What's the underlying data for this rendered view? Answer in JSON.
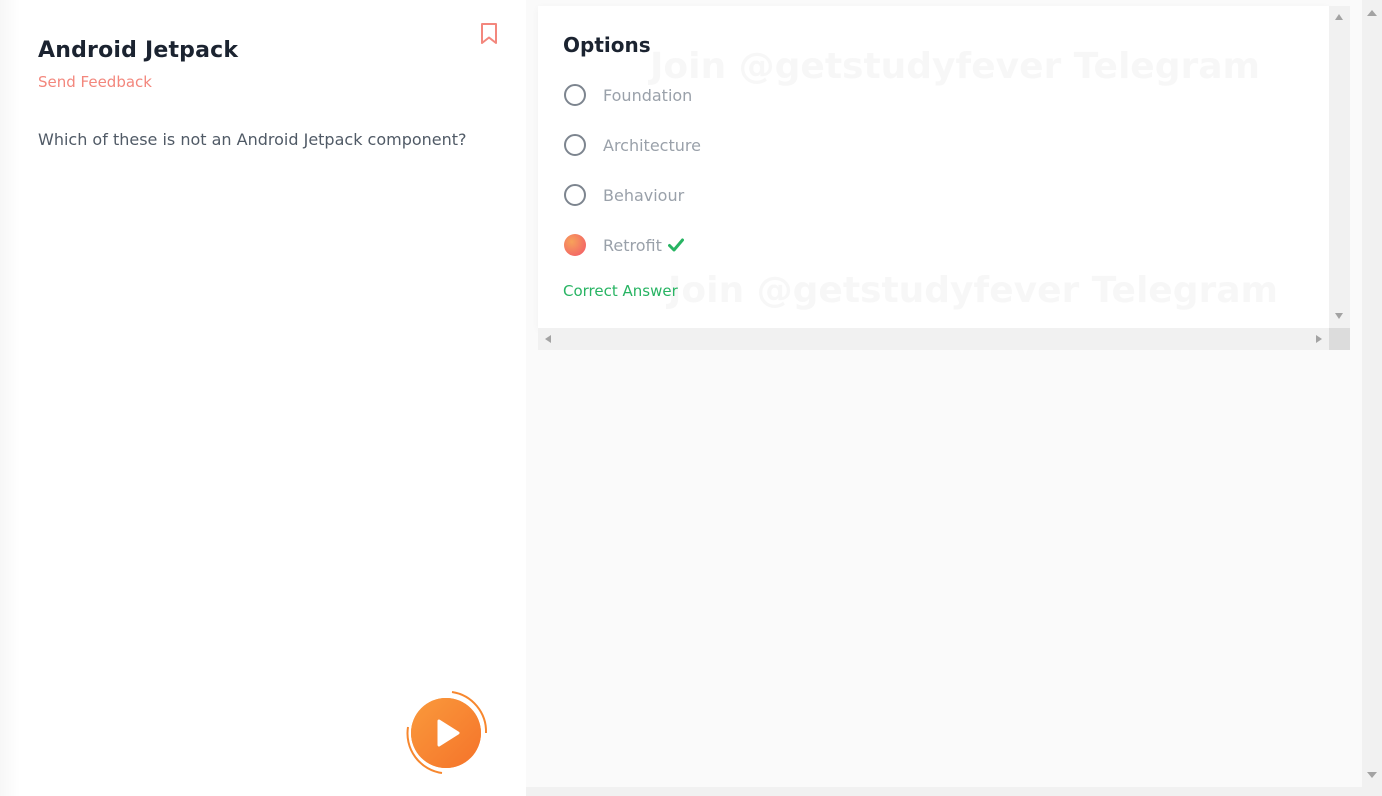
{
  "question_panel": {
    "title": "Android Jetpack",
    "feedback_link": "Send Feedback",
    "question": "Which of these is not an Android Jetpack component?"
  },
  "options_panel": {
    "title": "Options",
    "options": [
      {
        "label": "Foundation",
        "selected": false
      },
      {
        "label": "Architecture",
        "selected": false
      },
      {
        "label": "Behaviour",
        "selected": false
      },
      {
        "label": "Retrofit",
        "selected": true,
        "correct": true
      }
    ],
    "result_text": "Correct Answer",
    "watermark": "Join @getstudyfever Telegram"
  },
  "colors": {
    "accent": "#f3877d",
    "correct": "#28b463",
    "play_button": "#f7872e"
  },
  "icons": {
    "bookmark": "bookmark-icon",
    "play": "play-icon",
    "check": "check-icon"
  }
}
